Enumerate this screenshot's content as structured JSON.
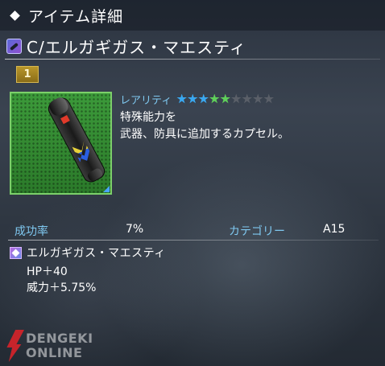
{
  "window": {
    "title": "アイテム詳細"
  },
  "item": {
    "name": "C/エルガギガス・マエスティ",
    "level": "1",
    "icon": "capsule-icon",
    "rarity": {
      "label": "レアリティ",
      "filled": 5,
      "total": 9,
      "stars": [
        {
          "color": "#3aa8f0"
        },
        {
          "color": "#3aa8f0"
        },
        {
          "color": "#3aa8f0"
        },
        {
          "color": "#5fd05a"
        },
        {
          "color": "#5fd05a"
        },
        {
          "color": "#5a5f68"
        },
        {
          "color": "#5a5f68"
        },
        {
          "color": "#5a5f68"
        },
        {
          "color": "#5a5f68"
        }
      ]
    },
    "description": {
      "line1": "特殊能力を",
      "line2": "武器、防具に追加するカプセル。"
    }
  },
  "stats": {
    "success_rate_label": "成功率",
    "success_rate_value": "7%",
    "category_label": "カテゴリー",
    "category_value": "A15"
  },
  "ability": {
    "icon": "ability-icon",
    "name": "エルガギガス・マエスティ",
    "effects": [
      "HP＋40",
      "威力＋5.75%"
    ]
  },
  "watermark": {
    "line1": "DENGEKI",
    "line2": "ONLINE"
  },
  "colors": {
    "accent_label": "#7fc8f0",
    "frame_green": "#7cd06a"
  }
}
